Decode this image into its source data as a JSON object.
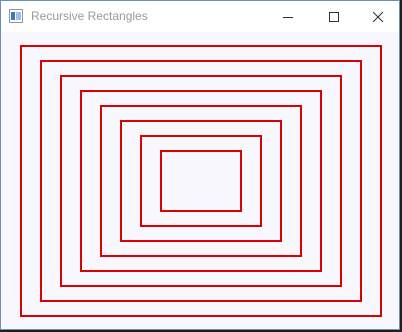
{
  "window": {
    "title": "Recursive Rectangles"
  },
  "titlebar_controls": {
    "minimize_icon": "minimize-icon",
    "maximize_icon": "maximize-icon",
    "close_icon": "close-icon"
  },
  "drawing": {
    "shape": "rectangle",
    "nested_rectangle_count": 8,
    "stroke_color": "#dd0000",
    "background_color": "#f8f7fd"
  }
}
